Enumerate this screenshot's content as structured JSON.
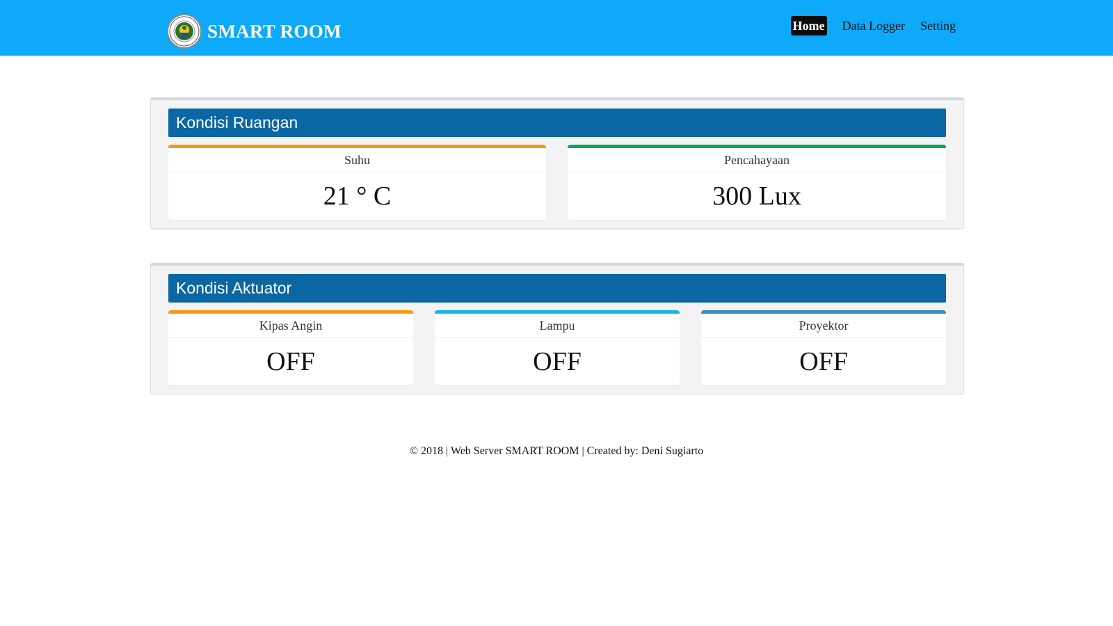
{
  "header": {
    "brand_title": "SMART ROOM",
    "logo_icon": "university-seal-icon",
    "nav": [
      {
        "label": "Home",
        "active": true
      },
      {
        "label": "Data Logger",
        "active": false
      },
      {
        "label": "Setting",
        "active": false
      }
    ],
    "colors": {
      "navbar": "#0ea9f9",
      "active_tab": "#0b0b0b"
    }
  },
  "room": {
    "title": "Kondisi Ruangan",
    "cards": [
      {
        "label": "Suhu",
        "value": "21 ° C",
        "accent": "#f39c12"
      },
      {
        "label": "Pencahayaan",
        "value": "300 Lux",
        "accent": "#00a65a"
      }
    ]
  },
  "actuator": {
    "title": "Kondisi Aktuator",
    "cards": [
      {
        "label": "Kipas Angin",
        "value": "OFF",
        "accent": "#f39c12"
      },
      {
        "label": "Lampu",
        "value": "OFF",
        "accent": "#17b6e6"
      },
      {
        "label": "Proyektor",
        "value": "OFF",
        "accent": "#3c8dbc"
      }
    ]
  },
  "panel_header_color": "#0a67a3",
  "footer": {
    "text": "© 2018 | Web Server SMART ROOM | Created by: Deni Sugiarto"
  }
}
